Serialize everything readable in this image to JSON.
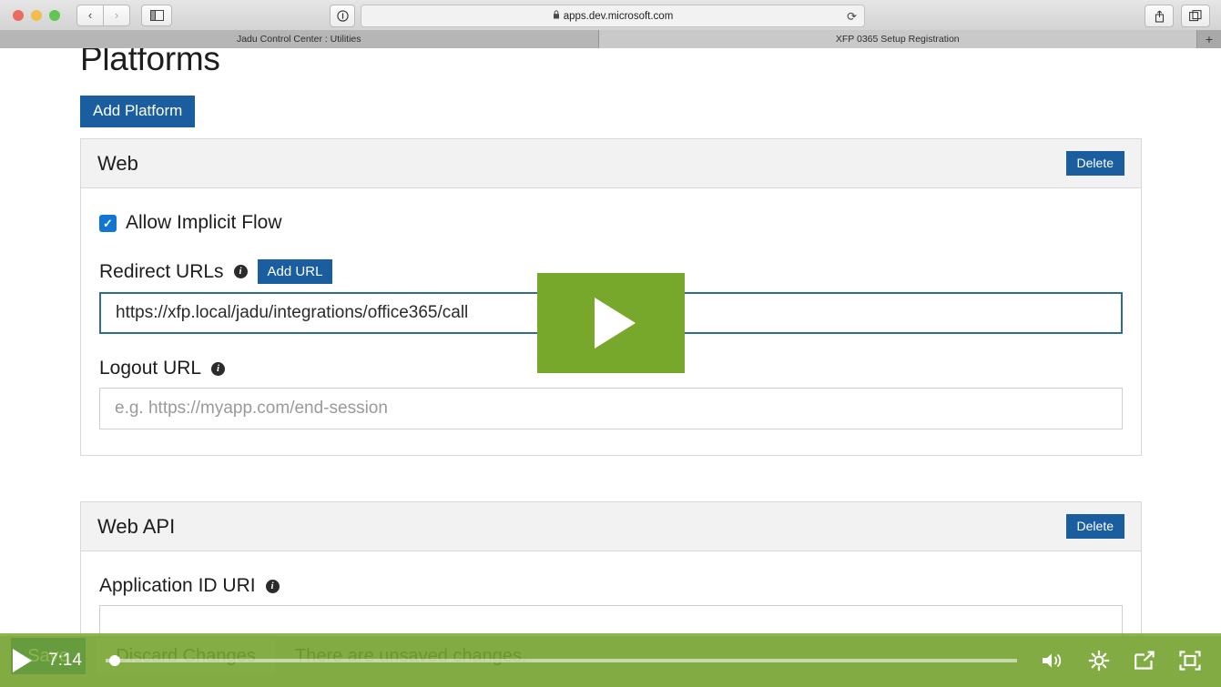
{
  "browser": {
    "traffic_lights": [
      "close",
      "minimize",
      "maximize"
    ],
    "back_label": "‹",
    "forward_label": "›",
    "sidebar_icon": "sidebar-icon",
    "info_icon": "info-circle-icon",
    "url": "apps.dev.microsoft.com",
    "lock_icon": "🔒",
    "reload_icon": "⟳",
    "share_icon": "share-icon",
    "tabs_icon": "tabs-icon",
    "tabs": [
      {
        "label": "Jadu Control Center : Utilities",
        "active": false
      },
      {
        "label": "XFP 0365 Setup Registration",
        "active": true
      }
    ],
    "new_tab_label": "+"
  },
  "page": {
    "title": "Platforms",
    "add_platform_label": "Add Platform",
    "panels": [
      {
        "name": "web",
        "title": "Web",
        "delete_label": "Delete",
        "checkbox": {
          "label": "Allow Implicit Flow",
          "checked": true,
          "mark": "✓"
        },
        "redirect_urls": {
          "label": "Redirect URLs",
          "info_icon": "i",
          "add_button_label": "Add URL",
          "value": "https://xfp.local/jadu/integrations/office365/call"
        },
        "logout_url": {
          "label": "Logout URL",
          "info_icon": "i",
          "value": "",
          "placeholder": "e.g. https://myapp.com/end-session"
        }
      },
      {
        "name": "web-api",
        "title": "Web API",
        "delete_label": "Delete",
        "application_id_uri": {
          "label": "Application ID URI",
          "info_icon": "i",
          "value": ""
        }
      }
    ],
    "bottom_bar": {
      "save_label": "Save",
      "discard_label": "Discard Changes",
      "unsaved_message": "There are unsaved changes."
    }
  },
  "video": {
    "play_overlay_icon": "play-icon",
    "play_button_icon": "play-icon",
    "time": "7:14",
    "progress_percent": 1,
    "volume_icon": "volume-icon",
    "settings_icon": "gear-icon",
    "share_icon": "share-icon",
    "fullscreen_icon": "fullscreen-icon"
  },
  "colors": {
    "accent_blue": "#1b5e9f",
    "checkbox_blue": "#1076d1",
    "video_green": "#77a82c",
    "focus_border": "#2f6a8f"
  }
}
